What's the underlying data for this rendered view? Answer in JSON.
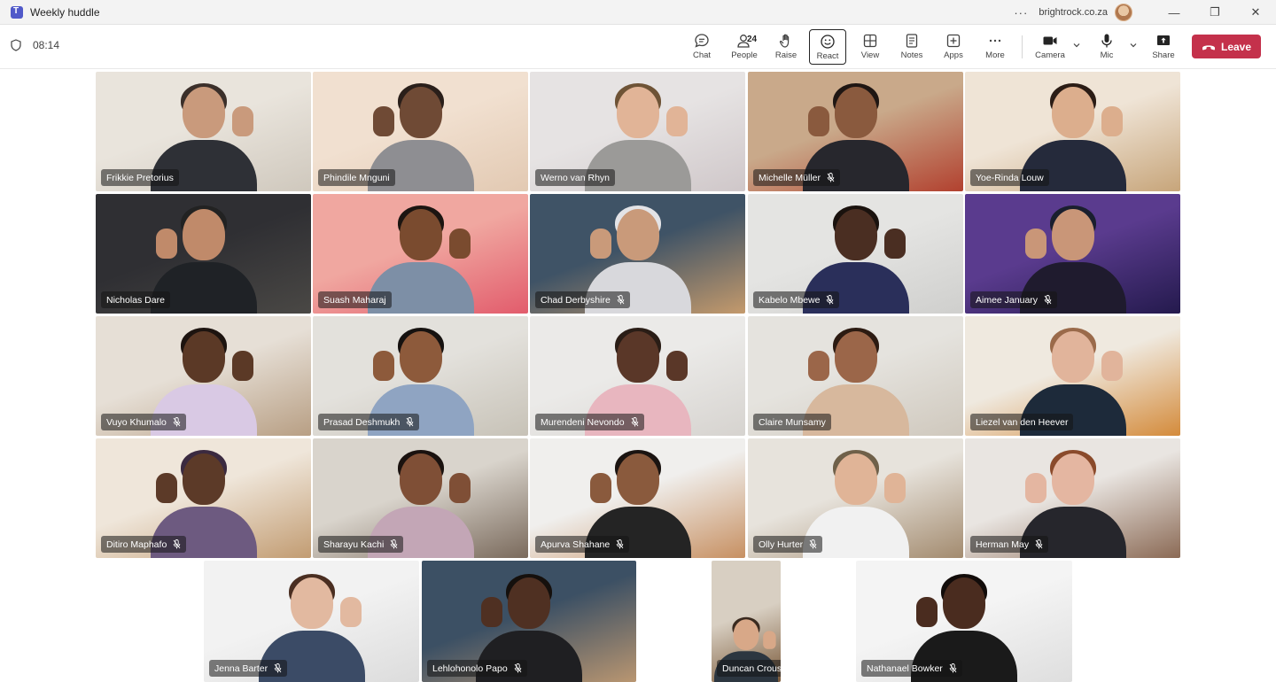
{
  "window": {
    "title": "Weekly huddle",
    "tenant": "brightrock.co.za",
    "more_dots": "···",
    "minimize": "—",
    "restore": "❐",
    "close": "✕"
  },
  "meeting": {
    "timer": "08:14",
    "people_count": "24"
  },
  "toolbar": {
    "chat": "Chat",
    "people": "People",
    "raise": "Raise",
    "react": "React",
    "view": "View",
    "notes": "Notes",
    "apps": "Apps",
    "more": "More",
    "camera": "Camera",
    "mic": "Mic",
    "share": "Share",
    "leave": "Leave"
  },
  "participants": [
    {
      "name": "Frikkie Pretorius",
      "muted": false,
      "bg": "#e9e4dc",
      "bg2": "#cfc8bd",
      "skin": "#c99a7c",
      "shirt": "#2e3036",
      "hair": "#3b2f2a"
    },
    {
      "name": "Phindile Mnguni",
      "muted": false,
      "bg": "#f1e0d0",
      "bg2": "#e2c9b2",
      "skin": "#6f4a35",
      "shirt": "#8e8e92",
      "hair": "#2a1f1a"
    },
    {
      "name": "Werno van Rhyn",
      "muted": false,
      "bg": "#e6e3e3",
      "bg2": "#cfc7c9",
      "skin": "#e1b497",
      "shirt": "#9b9a98",
      "hair": "#6e5336"
    },
    {
      "name": "Michelle Müller",
      "muted": true,
      "bg": "#c9a98a",
      "bg2": "#b2412f",
      "skin": "#8a5a3e",
      "shirt": "#27272d",
      "hair": "#1f1613"
    },
    {
      "name": "Yoe-Rinda Louw",
      "muted": false,
      "bg": "#efe4d6",
      "bg2": "#c7a57a",
      "skin": "#dcae8d",
      "shirt": "#252a3b",
      "hair": "#2b1c15"
    },
    {
      "name": "Nicholas Dare",
      "muted": false,
      "bg": "#2f2f33",
      "bg2": "#4a4845",
      "skin": "#c08a6a",
      "shirt": "#1f2226",
      "hair": "#222"
    },
    {
      "name": "Suash Maharaj",
      "muted": false,
      "bg": "#f0a7a0",
      "bg2": "#e25c6c",
      "skin": "#7a4b2f",
      "shirt": "#7d8fa6",
      "hair": "#1c1511"
    },
    {
      "name": "Chad Derbyshire",
      "muted": true,
      "bg": "#3f5366",
      "bg2": "#c49a6c",
      "skin": "#c99a7a",
      "shirt": "#d8d8dc",
      "hair": "#e3e3e6"
    },
    {
      "name": "Kabelo Mbewe",
      "muted": true,
      "bg": "#e4e4e2",
      "bg2": "#cfcfcd",
      "skin": "#4a2e22",
      "shirt": "#2a2f5a",
      "hair": "#1a120e"
    },
    {
      "name": "Aimee January",
      "muted": true,
      "bg": "#5a3b8e",
      "bg2": "#241a4d",
      "skin": "#c99678",
      "shirt": "#1f1b2e",
      "hair": "#1a1f2e"
    },
    {
      "name": "Vuyo Khumalo",
      "muted": true,
      "bg": "#e6dfd6",
      "bg2": "#b89f84",
      "skin": "#5b3926",
      "shirt": "#d9c9e4",
      "hair": "#1d1410"
    },
    {
      "name": "Prasad Deshmukh",
      "muted": true,
      "bg": "#e3e1dc",
      "bg2": "#c7c2b7",
      "skin": "#8d5a3b",
      "shirt": "#8fa4c2",
      "hair": "#161210"
    },
    {
      "name": "Murendeni Nevondo",
      "muted": true,
      "bg": "#ebeae8",
      "bg2": "#d6d3cf",
      "skin": "#5a3728",
      "shirt": "#e8b6bf",
      "hair": "#2a1d16"
    },
    {
      "name": "Claire Munsamy",
      "muted": false,
      "bg": "#e5e3de",
      "bg2": "#cfc8bd",
      "skin": "#9b6649",
      "shirt": "#d7b89d",
      "hair": "#2c1b12"
    },
    {
      "name": "Liezel van den Heever",
      "muted": false,
      "bg": "#efe9df",
      "bg2": "#d48b3b",
      "skin": "#e1b49b",
      "shirt": "#1d2a3a",
      "hair": "#9a6a4a"
    },
    {
      "name": "Ditiro Maphafo",
      "muted": true,
      "bg": "#efe6da",
      "bg2": "#c29c72",
      "skin": "#5c3a28",
      "shirt": "#6d5a80",
      "hair": "#3b2a40"
    },
    {
      "name": "Sharayu Kachi",
      "muted": true,
      "bg": "#d9d4cc",
      "bg2": "#7a6a5c",
      "skin": "#7f4f36",
      "shirt": "#c3a6b6",
      "hair": "#1a120f"
    },
    {
      "name": "Apurva Shahane",
      "muted": true,
      "bg": "#f0efed",
      "bg2": "#c79062",
      "skin": "#8a5a3d",
      "shirt": "#242424",
      "hair": "#1b1411"
    },
    {
      "name": "Olly Hurter",
      "muted": true,
      "bg": "#e7e3dc",
      "bg2": "#a38b6f",
      "skin": "#e0b497",
      "shirt": "#f1f1f1",
      "hair": "#6f6049"
    },
    {
      "name": "Herman May",
      "muted": true,
      "bg": "#e9e5e1",
      "bg2": "#8b6a55",
      "skin": "#e4b6a1",
      "shirt": "#26262c",
      "hair": "#8a4a2b"
    },
    {
      "name": "Jenna Barter",
      "muted": true,
      "bg": "#f2f2f2",
      "bg2": "#dcdcdc",
      "skin": "#e2b9a0",
      "shirt": "#3b4b66",
      "hair": "#4a2e21"
    },
    {
      "name": "Lehlohonolo Papo",
      "muted": true,
      "bg": "#3c5064",
      "bg2": "#b99671",
      "skin": "#4f3022",
      "shirt": "#1f1f22",
      "hair": "#15100d"
    },
    {
      "name": "Duncan Crous",
      "muted": true,
      "bg": "#d8cfc2",
      "bg2": "#7b5a3a",
      "skin": "#d8a888",
      "shirt": "#2c3640",
      "hair": "#3a2a1f"
    },
    {
      "name": "Nathanael Bowker",
      "muted": true,
      "bg": "#f4f4f4",
      "bg2": "#dedede",
      "skin": "#4a2c1f",
      "shirt": "#1a1a1a",
      "hair": "#120c0a"
    }
  ]
}
